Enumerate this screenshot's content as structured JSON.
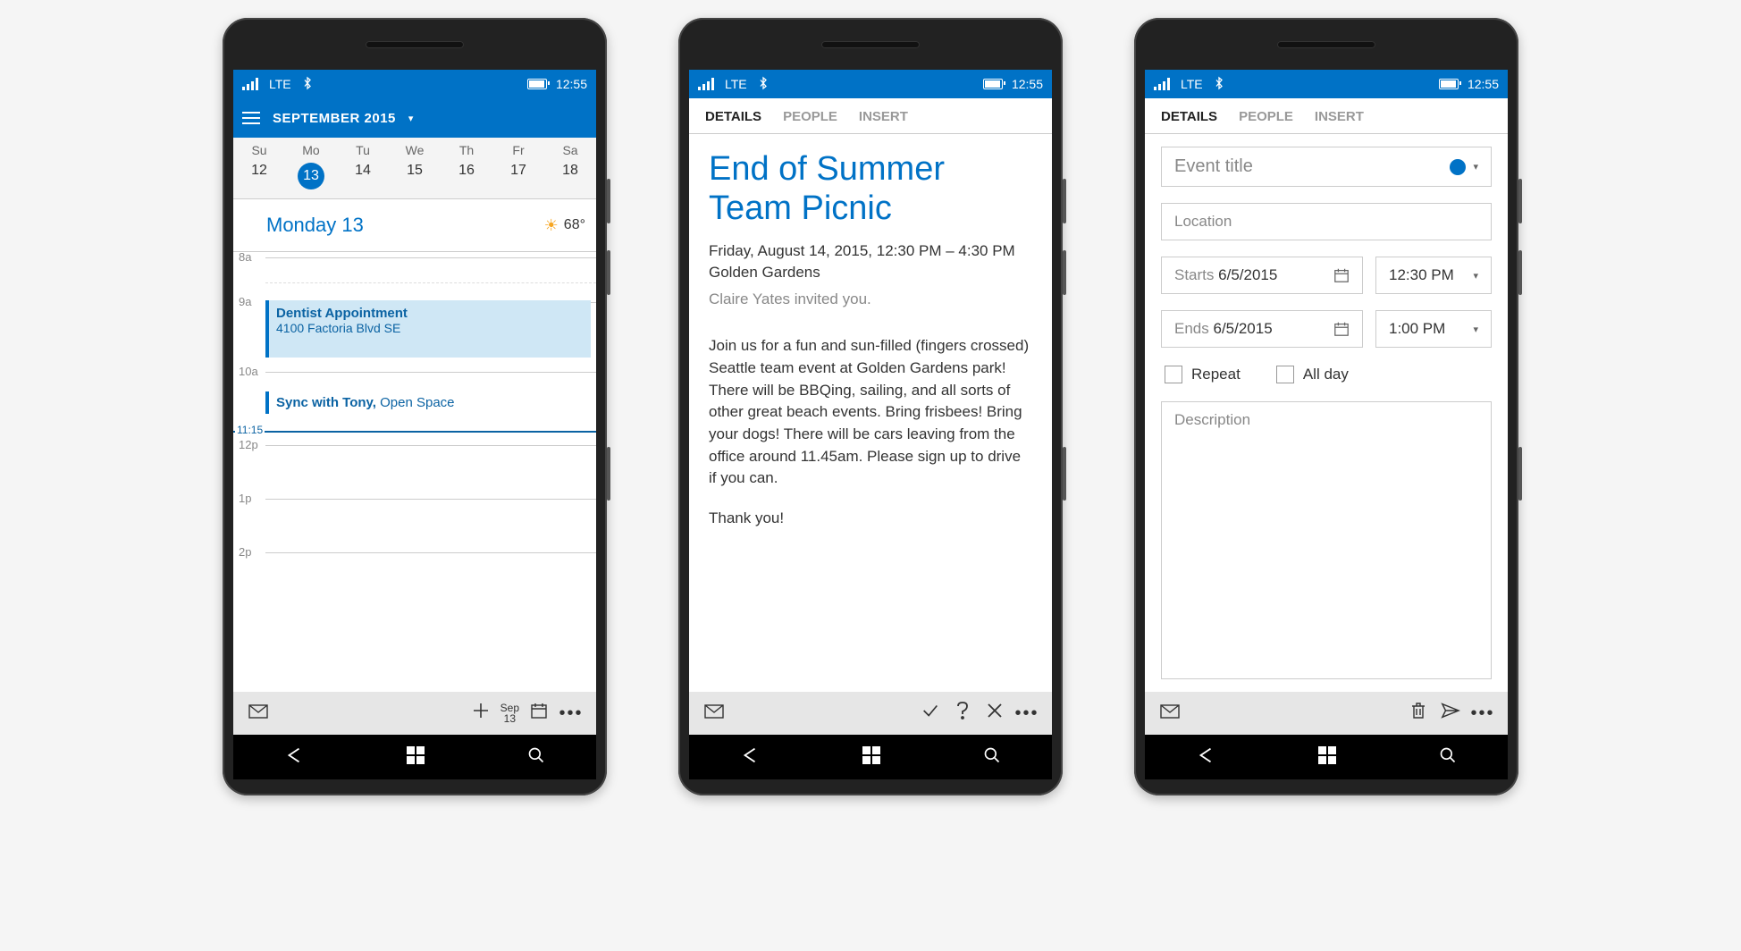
{
  "status": {
    "carrier": "LTE",
    "time": "12:55"
  },
  "phone1": {
    "header": {
      "month": "SEPTEMBER 2015"
    },
    "weekdays": [
      "Su",
      "Mo",
      "Tu",
      "We",
      "Th",
      "Fr",
      "Sa"
    ],
    "dates": [
      "12",
      "13",
      "14",
      "15",
      "16",
      "17",
      "18"
    ],
    "day_summary": {
      "date": "Monday 13",
      "temp": "68°"
    },
    "hours": [
      "8a",
      "9a",
      "10a",
      "11:15",
      "12p",
      "1p",
      "2p"
    ],
    "now": "11:15",
    "appt1": {
      "title": "Dentist Appointment",
      "sub": "4100 Factoria Blvd SE"
    },
    "appt2": {
      "title": "Sync with Tony,",
      "sub": " Open Space"
    },
    "appbar": {
      "sep_month": "Sep",
      "sep_day": "13"
    }
  },
  "phone2": {
    "tabs": [
      "DETAILS",
      "PEOPLE",
      "INSERT"
    ],
    "title": "End of Summer Team Picnic",
    "datetime": "Friday, August 14, 2015, 12:30 PM – 4:30 PM",
    "location": "Golden Gardens",
    "invited_by": "Claire Yates invited you.",
    "body1": "Join us for a fun and sun-filled (fingers crossed) Seattle team event at Golden Gardens park! There will be BBQing, sailing, and all sorts of other great beach events. Bring frisbees! Bring your dogs! There will be cars leaving from the office around 11.45am. Please sign up to drive if you can.",
    "body2": "Thank you!"
  },
  "phone3": {
    "tabs": [
      "DETAILS",
      "PEOPLE",
      "INSERT"
    ],
    "placeholders": {
      "title": "Event title",
      "location": "Location",
      "desc": "Description"
    },
    "starts_label": "Starts",
    "starts_date": "6/5/2015",
    "starts_time": "12:30 PM",
    "ends_label": "Ends",
    "ends_date": "6/5/2015",
    "ends_time": "1:00 PM",
    "repeat": "Repeat",
    "allday": "All day"
  }
}
